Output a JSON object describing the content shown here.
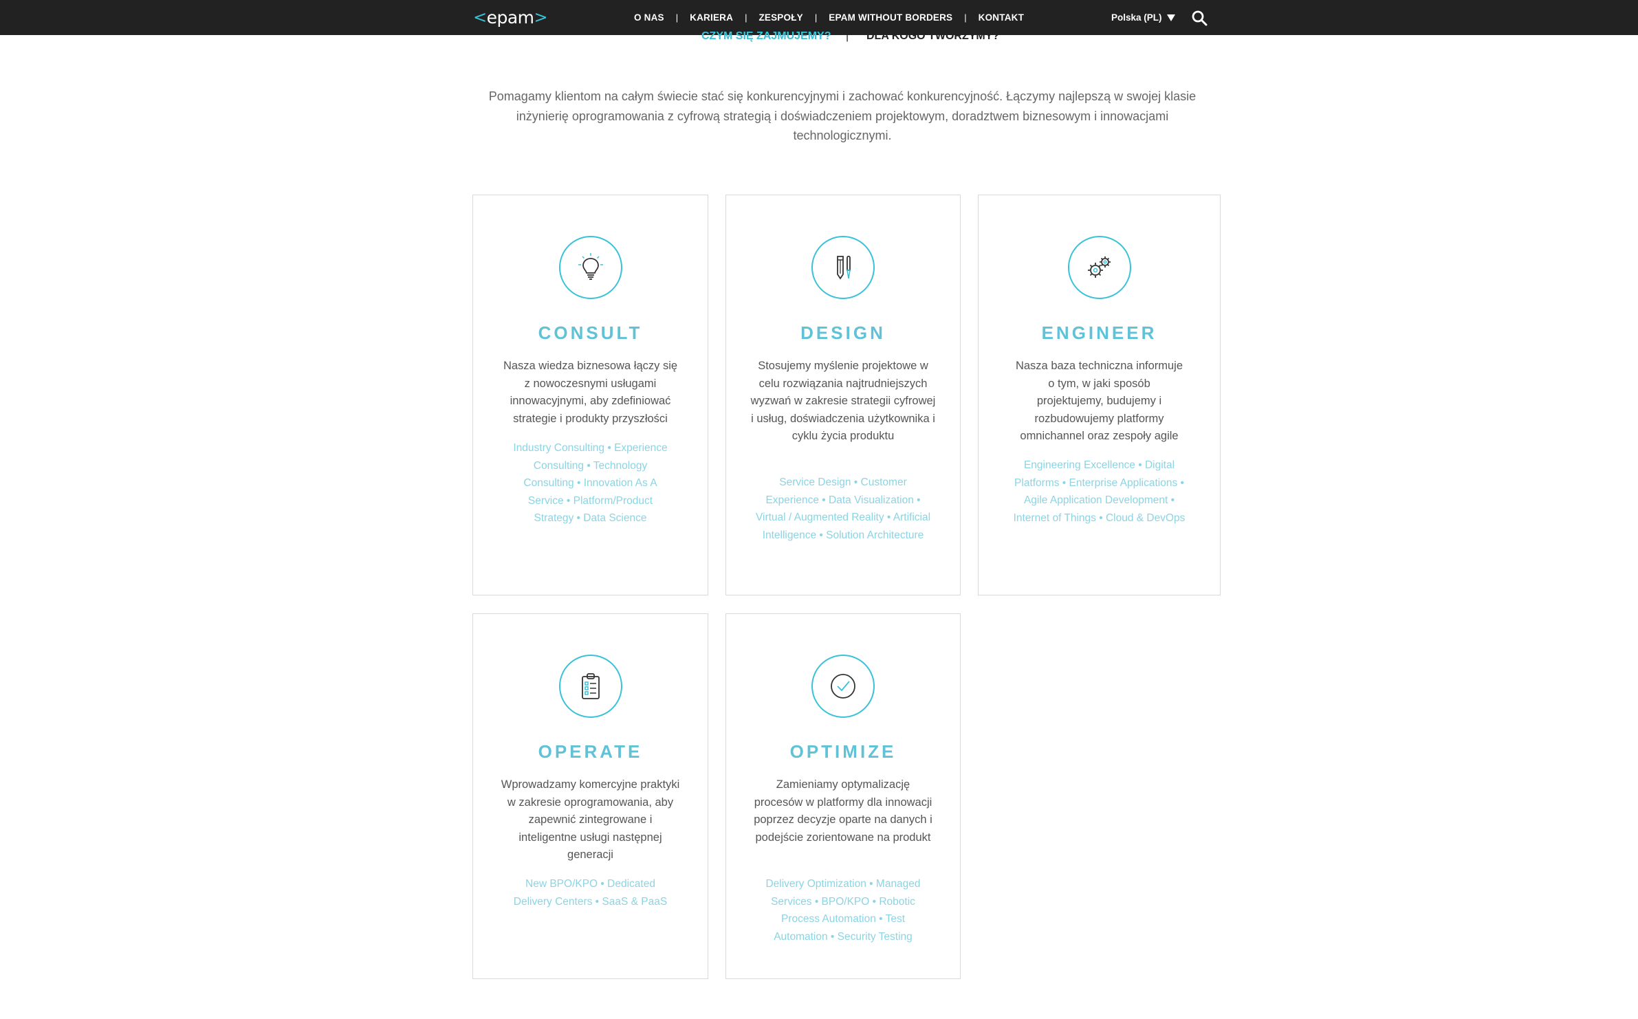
{
  "header": {
    "logo": "epam",
    "nav": [
      "O NAS",
      "KARIERA",
      "ZESPOŁY",
      "EPAM WITHOUT BORDERS",
      "KONTAKT"
    ],
    "language": "Polska (PL)"
  },
  "subnav": {
    "active": "CZYM SIĘ ZAJMUJEMY?",
    "separator": "|",
    "other": "DLA KOGO TWORZYMY?"
  },
  "intro": "Pomagamy klientom na całym świecie stać się konkurencyjnymi i zachować konkurencyjność. Łączymy najlepszą w swojej klasie inżynierię oprogramowania z cyfrową strategią i doświadczeniem projektowym, doradztwem biznesowym i innowacjami technologicznymi.",
  "accent_color": "#39c2d7",
  "cards": [
    {
      "icon": "lightbulb-icon",
      "title": "CONSULT",
      "description": "Nasza wiedza biznesowa łączy się z nowoczesnymi usługami innowacyjnymi, aby zdefiniować strategie i produkty przyszłości",
      "tags": "Industry Consulting • Experience Consulting • Technology Consulting • Innovation As A Service • Platform/Product Strategy • Data Science"
    },
    {
      "icon": "pencil-pen-icon",
      "title": "DESIGN",
      "description": "Stosujemy myślenie projektowe w celu rozwiązania najtrudniejszych wyzwań w zakresie strategii cyfrowej i usług, doświadczenia użytkownika i cyklu życia produktu",
      "tags": "Service Design • Customer Experience • Data Visualization • Virtual / Augmented Reality • Artificial Intelligence • Solution Architecture"
    },
    {
      "icon": "gears-icon",
      "title": "ENGINEER",
      "description": "Nasza baza techniczna informuje o tym, w jaki sposób projektujemy, budujemy i rozbudowujemy platformy omnichannel oraz zespoły agile",
      "tags": "Engineering Excellence • Digital Platforms • Enterprise Applications • Agile Application Development • Internet of Things • Cloud & DevOps"
    },
    {
      "icon": "clipboard-icon",
      "title": "OPERATE",
      "description": "Wprowadzamy komercyjne praktyki w zakresie oprogramowania, aby zapewnić zintegrowane i inteligentne usługi następnej generacji",
      "tags": "New BPO/KPO • Dedicated Delivery Centers • SaaS & PaaS"
    },
    {
      "icon": "checkmark-circle-icon",
      "title": "OPTIMIZE",
      "description": "Zamieniamy optymalizację procesów w platformy dla innowacji poprzez decyzje oparte na danych i podejście zorientowane na produkt",
      "tags": "Delivery Optimization • Managed Services • BPO/KPO • Robotic Process Automation • Test Automation • Security Testing"
    }
  ]
}
